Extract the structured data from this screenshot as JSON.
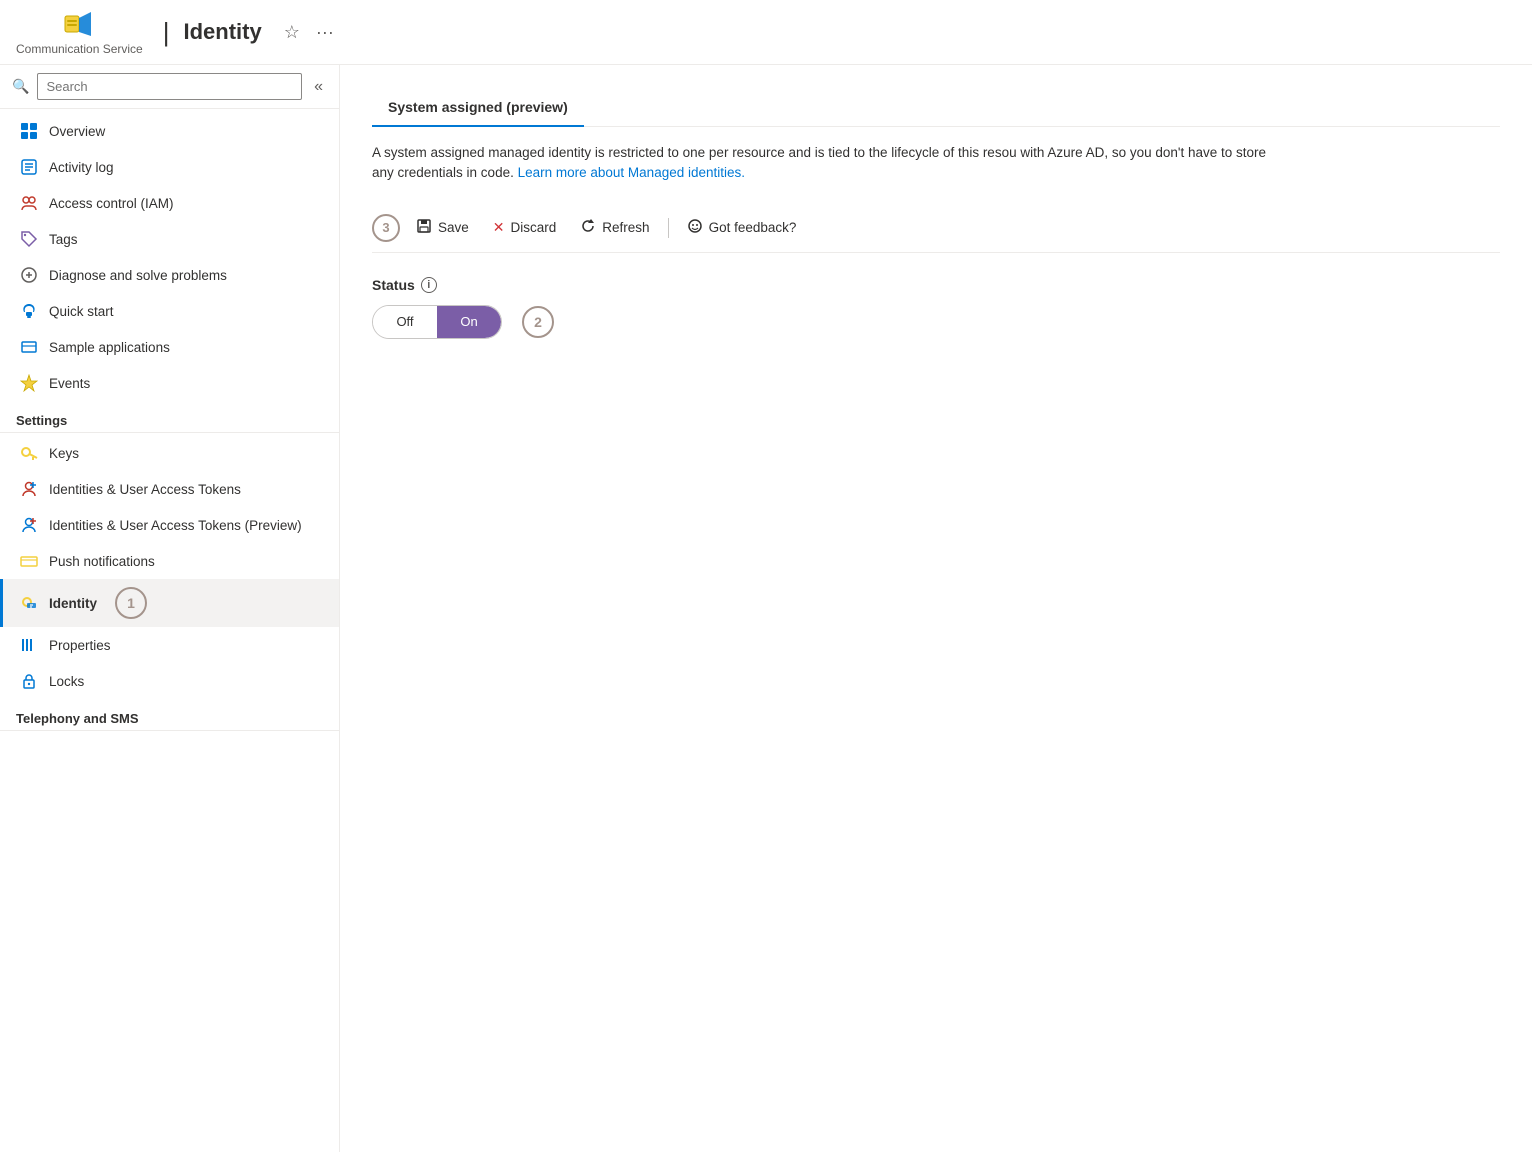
{
  "topbar": {
    "service_name": "Communication Service",
    "title": "Identity",
    "star_icon": "☆",
    "more_icon": "···"
  },
  "sidebar": {
    "search_placeholder": "Search",
    "collapse_icon": "«",
    "nav_items": [
      {
        "id": "overview",
        "label": "Overview",
        "icon": "🗂",
        "active": false,
        "section": null
      },
      {
        "id": "activity-log",
        "label": "Activity log",
        "icon": "📋",
        "active": false,
        "section": null
      },
      {
        "id": "access-control",
        "label": "Access control (IAM)",
        "icon": "👥",
        "active": false,
        "section": null
      },
      {
        "id": "tags",
        "label": "Tags",
        "icon": "🏷",
        "active": false,
        "section": null
      },
      {
        "id": "diagnose",
        "label": "Diagnose and solve problems",
        "icon": "🔧",
        "active": false,
        "section": null
      },
      {
        "id": "quick-start",
        "label": "Quick start",
        "icon": "☁",
        "active": false,
        "section": null
      },
      {
        "id": "sample-apps",
        "label": "Sample applications",
        "icon": "📊",
        "active": false,
        "section": null
      },
      {
        "id": "events",
        "label": "Events",
        "icon": "⚡",
        "active": false,
        "section": null
      },
      {
        "id": "settings-section",
        "label": "Settings",
        "icon": null,
        "active": false,
        "section": "Settings"
      },
      {
        "id": "keys",
        "label": "Keys",
        "icon": "🔑",
        "active": false,
        "section": null
      },
      {
        "id": "identities-tokens",
        "label": "Identities & User Access Tokens",
        "icon": "👤",
        "active": false,
        "section": null
      },
      {
        "id": "identities-tokens-preview",
        "label": "Identities & User Access Tokens (Preview)",
        "icon": "👤",
        "active": false,
        "section": null
      },
      {
        "id": "push-notifications",
        "label": "Push notifications",
        "icon": "📬",
        "active": false,
        "section": null
      },
      {
        "id": "identity",
        "label": "Identity",
        "icon": "🔑",
        "active": true,
        "section": null
      },
      {
        "id": "properties",
        "label": "Properties",
        "icon": "📊",
        "active": false,
        "section": null
      },
      {
        "id": "locks",
        "label": "Locks",
        "icon": "🔒",
        "active": false,
        "section": null
      },
      {
        "id": "telephony-section",
        "label": "Telephony and SMS",
        "icon": null,
        "active": false,
        "section": "Telephony and SMS"
      }
    ]
  },
  "content": {
    "tabs": [
      {
        "id": "system-assigned",
        "label": "System assigned (preview)",
        "active": true
      }
    ],
    "description": "A system assigned managed identity is restricted to one per resource and is tied to the lifecycle of this resou with Azure AD, so you don't have to store any credentials in code.",
    "learn_more_text": "Learn more about Managed identities.",
    "learn_more_href": "#",
    "toolbar": {
      "save_label": "Save",
      "discard_label": "Discard",
      "refresh_label": "Refresh",
      "feedback_label": "Got feedback?"
    },
    "status": {
      "label": "Status",
      "toggle_off": "Off",
      "toggle_on": "On",
      "toggle_state": "on"
    },
    "badges": {
      "badge1": "1",
      "badge2": "2",
      "badge3": "3"
    }
  }
}
